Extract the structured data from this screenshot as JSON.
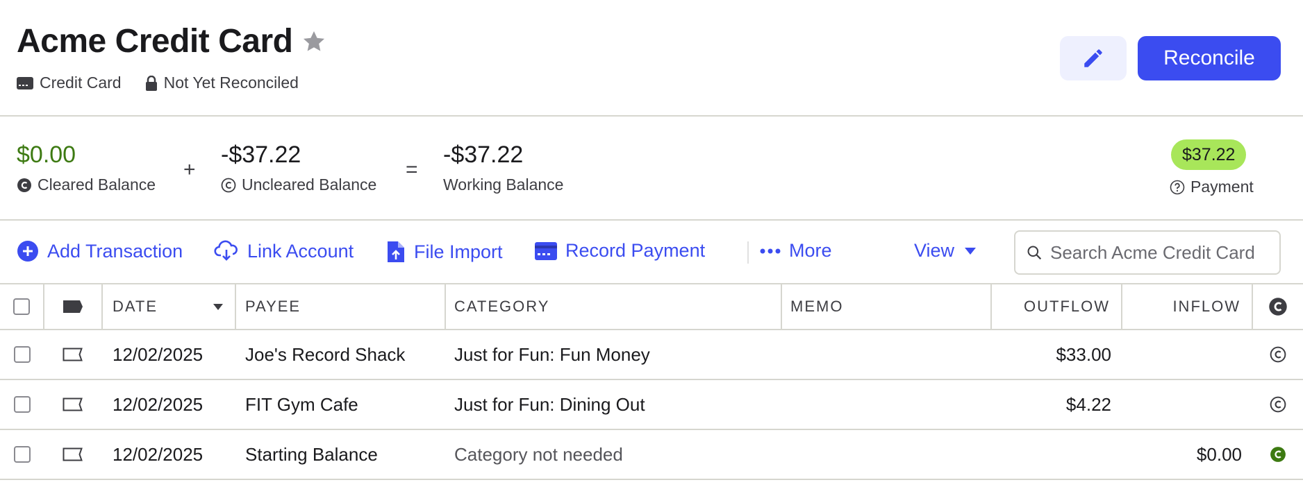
{
  "header": {
    "title": "Acme Credit Card",
    "account_type": "Credit Card",
    "reconcile_status": "Not Yet Reconciled",
    "reconcile_button": "Reconcile",
    "edit_icon": "pencil-icon",
    "favorite_icon": "star-icon"
  },
  "balances": {
    "cleared": {
      "value": "$0.00",
      "label": "Cleared Balance"
    },
    "plus": "+",
    "uncleared": {
      "value": "-$37.22",
      "label": "Uncleared Balance"
    },
    "equals": "=",
    "working": {
      "value": "-$37.22",
      "label": "Working Balance"
    },
    "payment": {
      "value": "$37.22",
      "label": "Payment"
    }
  },
  "toolbar": {
    "add_transaction": "Add Transaction",
    "link_account": "Link Account",
    "file_import": "File Import",
    "record_payment": "Record Payment",
    "more": "More",
    "view": "View",
    "search_placeholder": "Search Acme Credit Card"
  },
  "table": {
    "columns": {
      "date": "DATE",
      "payee": "PAYEE",
      "category": "CATEGORY",
      "memo": "MEMO",
      "outflow": "OUTFLOW",
      "inflow": "INFLOW"
    },
    "rows": [
      {
        "date": "12/02/2025",
        "payee": "Joe's Record Shack",
        "category": "Just for Fun: Fun Money",
        "memo": "",
        "outflow": "$33.00",
        "inflow": "",
        "cleared": false
      },
      {
        "date": "12/02/2025",
        "payee": "FIT Gym Cafe",
        "category": "Just for Fun: Dining Out",
        "memo": "",
        "outflow": "$4.22",
        "inflow": "",
        "cleared": false
      },
      {
        "date": "12/02/2025",
        "payee": "Starting Balance",
        "category": "Category not needed",
        "memo": "",
        "outflow": "",
        "inflow": "$0.00",
        "cleared": true
      }
    ]
  },
  "colors": {
    "accent": "#3b4cf0",
    "cleared_green": "#3d7a12",
    "payment_pill": "#a8e65a",
    "border": "#d6d6cf"
  }
}
